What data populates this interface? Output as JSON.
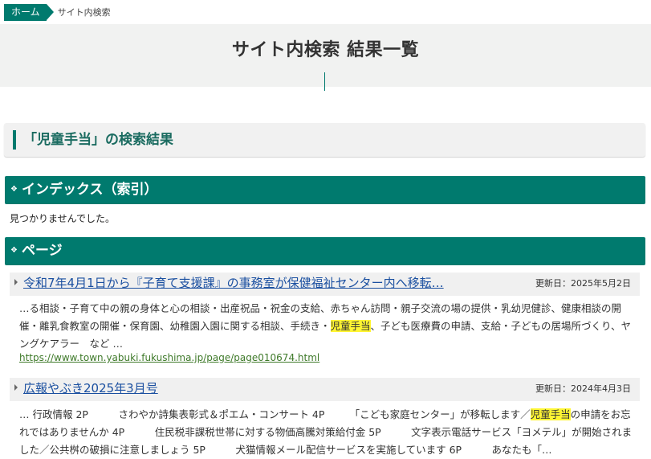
{
  "breadcrumb": {
    "home": "ホーム",
    "current": "サイト内検索"
  },
  "page_title": "サイト内検索 結果一覧",
  "results_heading": "「児童手当」の検索結果",
  "sections": {
    "index": {
      "title": "インデックス（索引）",
      "empty_message": "見つかりませんでした。"
    },
    "pages": {
      "title": "ページ"
    }
  },
  "results": [
    {
      "title": "令和7年4月1日から『子育て支援課』の事務室が保健福祉センター内へ移転…",
      "updated": "更新日：2025年5月2日",
      "snippet_before": "…る相談・子育て中の親の身体と心の相談・出産祝品・祝金の支給、赤ちゃん訪問・親子交流の場の提供・乳幼児健診、健康相談の開催・離乳食教室の開催・保育園、幼稚園入園に関する相談、手続き・",
      "snippet_highlight": "児童手当",
      "snippet_after": "、子ども医療費の申請、支給・子どもの居場所づくり、ヤングケアラー　など …",
      "url": "https://www.town.yabuki.fukushima.jp/page/page010674.html"
    },
    {
      "title": "広報やぶき2025年3月号",
      "updated": "更新日：2024年4月3日",
      "snippet_before": "… 行政情報 2P　　　さわやか詩集表彰式＆ポエム・コンサート 4P　　　「こども家庭センター」が移転します／",
      "snippet_highlight": "児童手当",
      "snippet_after": "の申請をお忘れではありませんか 4P　　　住民税非課税世帯に対する物価高騰対策給付金 5P　　　文字表示電話サービス「ヨメテル」が開始されました／公共桝の破損に注意しましょう 5P　　　犬猫情報メール配信サービスを実施しています 6P　　　あなたも「…"
    }
  ],
  "colors": {
    "accent": "#007a6e",
    "highlight": "#fff533",
    "link": "#1a4fa0",
    "url": "#3f7a2a"
  }
}
